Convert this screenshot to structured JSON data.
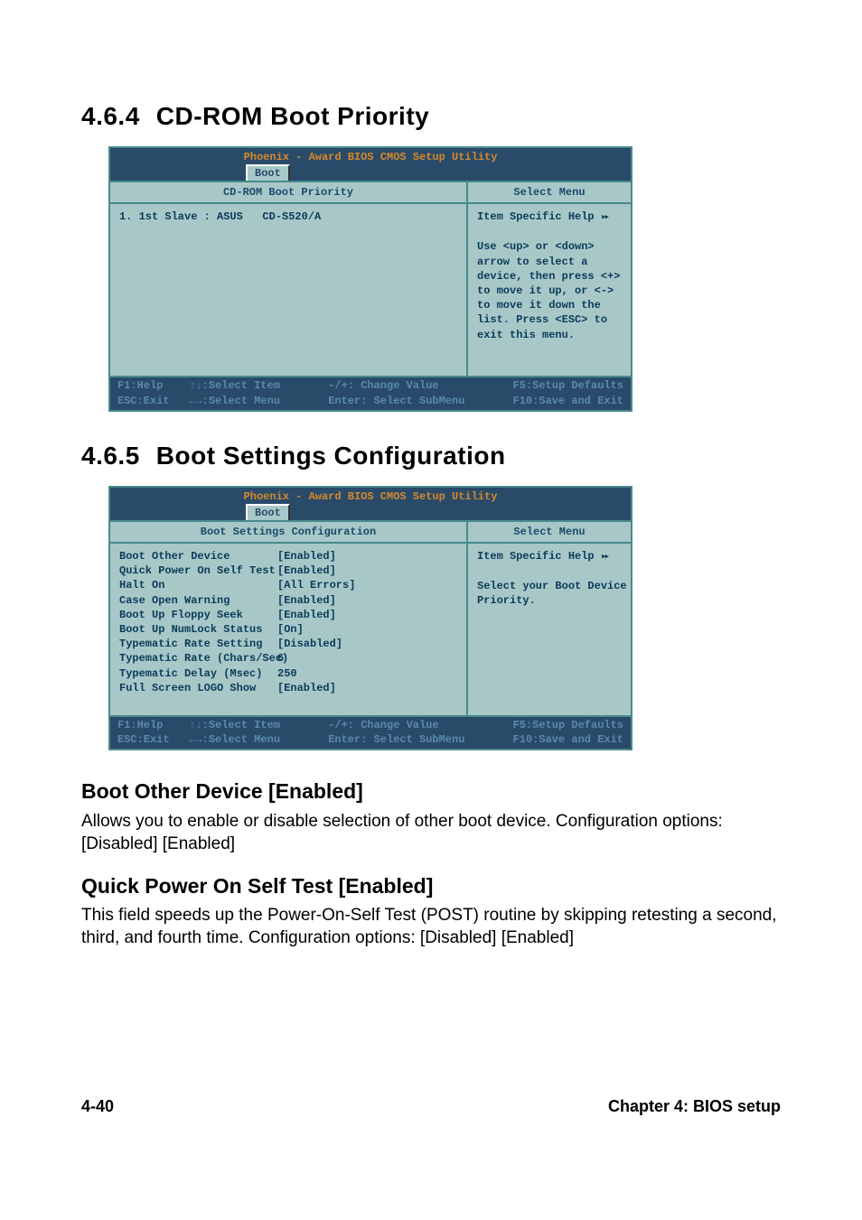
{
  "section1": {
    "number": "4.6.4",
    "title": "CD-ROM Boot Priority"
  },
  "section2": {
    "number": "4.6.5",
    "title": "Boot Settings Configuration"
  },
  "bios": {
    "app_title": "Phoenix - Award BIOS CMOS Setup Utility",
    "tab": "Boot",
    "select_menu": "Select Menu",
    "help_heading": "Item Specific Help",
    "footer": {
      "left": "F1:Help    ↑↓:Select Item\nESC:Exit   ←→:Select Menu",
      "mid": "-/+: Change Value\nEnter: Select SubMenu",
      "right": "F5:Setup Defaults\nF10:Save and Exit"
    }
  },
  "bios1": {
    "left_header": "CD-ROM Boot Priority",
    "items": [
      "1. 1st Slave : ASUS   CD-S520/A"
    ],
    "help_text": "Use <up> or <down>\narrow to select a\ndevice, then press <+>\nto move it up, or <->\nto move it down the\nlist. Press <ESC> to\nexit this menu."
  },
  "bios2": {
    "left_header": "Boot Settings Configuration",
    "settings": [
      {
        "k": "Boot Other Device",
        "v": "[Enabled]"
      },
      {
        "k": "Quick Power On Self Test",
        "v": "[Enabled]"
      },
      {
        "k": "Halt On",
        "v": "[All Errors]"
      },
      {
        "k": "Case Open Warning",
        "v": "[Enabled]"
      },
      {
        "k": "Boot Up Floppy Seek",
        "v": "[Enabled]"
      },
      {
        "k": "Boot Up NumLock Status",
        "v": "[On]"
      },
      {
        "k": "Typematic Rate Setting",
        "v": "[Disabled]"
      },
      {
        "k": "Typematic Rate (Chars/Sec)",
        "v": "6"
      },
      {
        "k": "Typematic Delay (Msec)",
        "v": "250"
      },
      {
        "k": "Full Screen LOGO Show",
        "v": "[Enabled]"
      }
    ],
    "help_text": "Select your Boot Device\nPriority."
  },
  "options": {
    "boot_other_device": {
      "heading": "Boot Other Device [Enabled]",
      "body": "Allows you to enable or disable selection of other boot device. Configuration options: [Disabled] [Enabled]"
    },
    "quick_post": {
      "heading": "Quick Power On Self Test [Enabled]",
      "body": "This field speeds up the Power-On-Self Test (POST) routine by skipping retesting a second, third, and fourth time. Configuration options: [Disabled] [Enabled]"
    }
  },
  "footer": {
    "page": "4-40",
    "chapter": "Chapter 4: BIOS setup"
  }
}
